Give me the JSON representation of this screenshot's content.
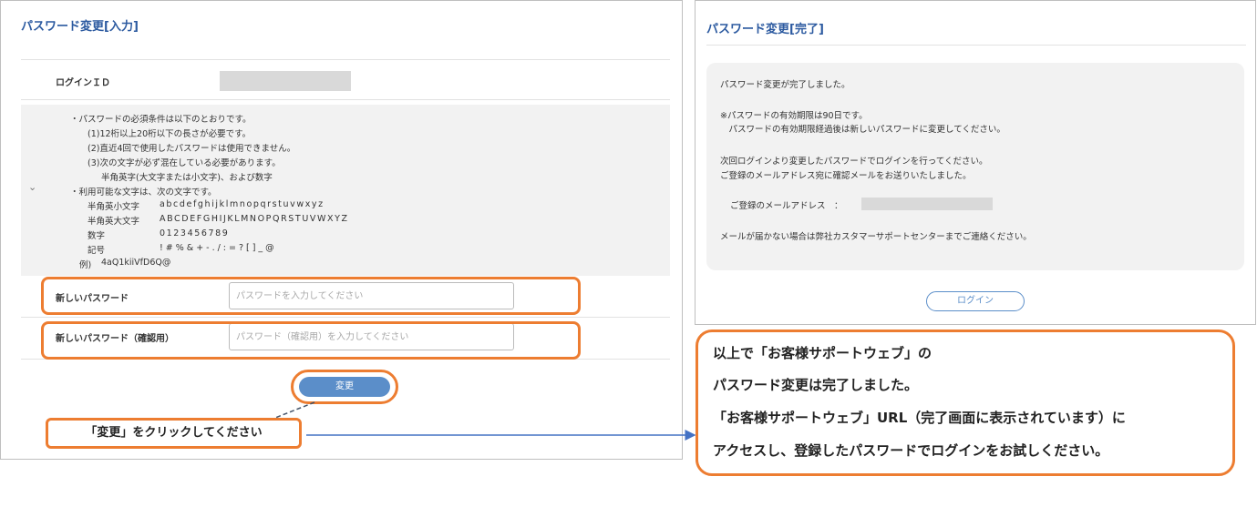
{
  "left": {
    "title": "パスワード変更[入力]",
    "login_id_label": "ログインＩＤ",
    "notes": {
      "heading": "・パスワードの必須条件は以下のとおりです。",
      "rules": [
        "(1)12桁以上20桁以下の長さが必要です。",
        "(2)直近4回で使用したパスワードは使用できません。",
        "(3)次の文字が必ず混在している必要があります。"
      ],
      "rule3_detail": "半角英字(大文字または小文字)、および数字",
      "allowed_heading": "・利用可能な文字は、次の文字です。",
      "char_rows": [
        {
          "label": "半角英小文字",
          "value": "abcdefghijklmnopqrstuvwxyz"
        },
        {
          "label": "半角英大文字",
          "value": "ABCDEFGHIJKLMNOPQRSTUVWXYZ"
        },
        {
          "label": "数字",
          "value": "0123456789"
        },
        {
          "label": "記号",
          "value": "!#%&+-./:=?[]_@"
        }
      ],
      "example_label": "例)",
      "example_value": "4aQ1kiiVfD6Q@"
    },
    "new_password": {
      "label": "新しいパスワード",
      "placeholder": "パスワードを入力してください"
    },
    "confirm_password": {
      "label": "新しいパスワード（確認用）",
      "placeholder": "パスワード（確認用）を入力してください"
    },
    "change_button": "変更",
    "callout": "「変更」をクリックしてください"
  },
  "right": {
    "title": "パスワード変更[完了]",
    "message_lines": [
      "パスワード変更が完了しました。",
      "※パスワードの有効期限は90日です。",
      "　パスワードの有効期限経過後は新しいパスワードに変更してください。",
      "次回ログインより変更したパスワードでログインを行ってください。",
      "ご登録のメールアドレス宛に確認メールをお送りいたしました。",
      "メールが届かない場合は弊社カスタマーサポートセンターまでご連絡ください。"
    ],
    "email_label": "ご登録のメールアドレス　：",
    "login_button": "ログイン",
    "callout_lines": [
      "以上で「お客様サポートウェブ」の",
      "パスワード変更は完了しました。",
      "「お客様サポートウェブ」URL（完了画面に表示されています）に",
      "アクセスし、登録したパスワードでログインをお試しください。"
    ]
  },
  "colors": {
    "accent": "#2c5aa0",
    "callout_border": "#ed7d31",
    "button": "#5b8ec9",
    "panel_bg": "#f2f2f2"
  }
}
